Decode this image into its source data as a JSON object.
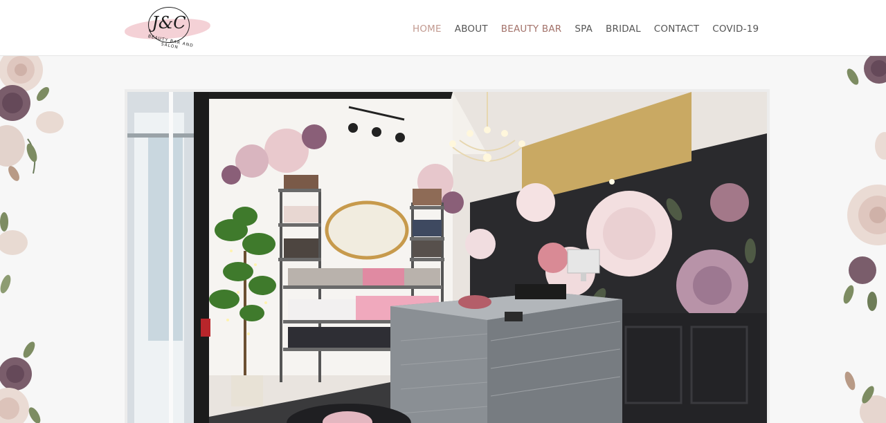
{
  "logo": {
    "monogram": "J&C",
    "tagline": "BEAUTY BAR AND SALON"
  },
  "nav": {
    "items": [
      {
        "label": "HOME",
        "state": "active"
      },
      {
        "label": "ABOUT",
        "state": "normal"
      },
      {
        "label": "BEAUTY BAR",
        "state": "accent"
      },
      {
        "label": "SPA",
        "state": "normal"
      },
      {
        "label": "BRIDAL",
        "state": "normal"
      },
      {
        "label": "CONTACT",
        "state": "normal"
      },
      {
        "label": "COVID-19",
        "state": "normal"
      }
    ]
  },
  "colors": {
    "nav_text": "#555555",
    "nav_active": "#c29a90",
    "nav_accent": "#a3726a",
    "page_bg": "#f7f7f7",
    "logo_blush": "#f2c9cf"
  },
  "hero": {
    "image_icon": "salon-interior-photo"
  }
}
